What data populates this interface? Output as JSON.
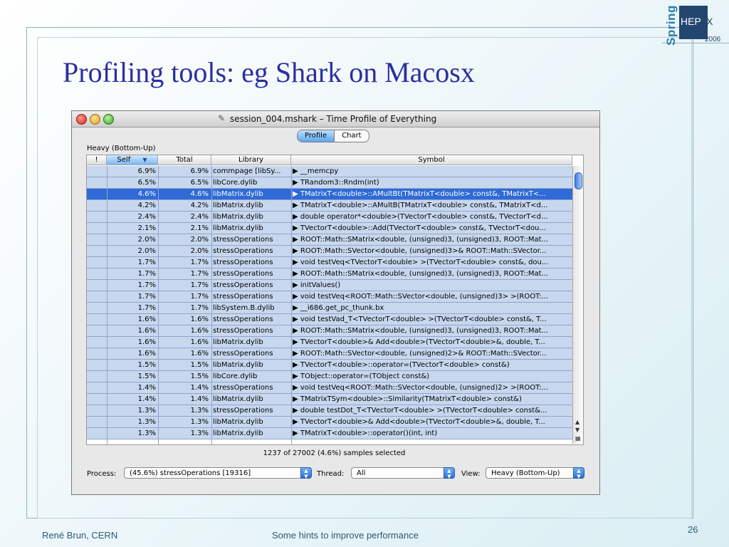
{
  "logo": {
    "spring": "Spring",
    "hep": "HEP",
    "ix": "iX",
    "year": "2006"
  },
  "slide": {
    "title": "Profiling tools: eg Shark on Macosx",
    "footer_left": "René Brun, CERN",
    "footer_center": "Some hints to improve performance",
    "page_number": "26"
  },
  "window": {
    "title": "session_004.mshark – Time Profile of Everything",
    "tabs": [
      "Profile",
      "Chart"
    ],
    "pane_label": "Heavy (Bottom-Up)",
    "columns": [
      "!",
      "Self",
      "Total",
      "Library",
      "Symbol"
    ],
    "rows": [
      {
        "self": "6.9%",
        "total": "6.9%",
        "library": "commpage [libSy...",
        "symbol": "▶ __memcpy"
      },
      {
        "self": "6.5%",
        "total": "6.5%",
        "library": "libCore.dylib",
        "symbol": "▶ TRandom3::Rndm(int)"
      },
      {
        "self": "4.6%",
        "total": "4.6%",
        "library": "libMatrix.dylib",
        "symbol": "▶ TMatrixT<double>::AMultBt(TMatrixT<double> const&, TMatrixT<..."
      },
      {
        "self": "4.2%",
        "total": "4.2%",
        "library": "libMatrix.dylib",
        "symbol": "▶ TMatrixT<double>::AMultB(TMatrixT<double> const&, TMatrixT<d..."
      },
      {
        "self": "2.4%",
        "total": "2.4%",
        "library": "libMatrix.dylib",
        "symbol": "▶ double operator*<double>(TVectorT<double> const&, TVectorT<d..."
      },
      {
        "self": "2.1%",
        "total": "2.1%",
        "library": "libMatrix.dylib",
        "symbol": "▶ TVectorT<double>::Add(TVectorT<double> const&, TVectorT<dou..."
      },
      {
        "self": "2.0%",
        "total": "2.0%",
        "library": "stressOperations",
        "symbol": "▶ ROOT::Math::SMatrix<double, (unsigned)3, (unsigned)3, ROOT::Mat..."
      },
      {
        "self": "2.0%",
        "total": "2.0%",
        "library": "stressOperations",
        "symbol": "▶ ROOT::Math::SVector<double, (unsigned)3>& ROOT::Math::SVector..."
      },
      {
        "self": "1.7%",
        "total": "1.7%",
        "library": "stressOperations",
        "symbol": "▶ void testVeq<TVectorT<double> >(TVectorT<double> const&, dou..."
      },
      {
        "self": "1.7%",
        "total": "1.7%",
        "library": "stressOperations",
        "symbol": "▶ ROOT::Math::SMatrix<double, (unsigned)3, (unsigned)3, ROOT::Mat..."
      },
      {
        "self": "1.7%",
        "total": "1.7%",
        "library": "stressOperations",
        "symbol": "▶ initValues()"
      },
      {
        "self": "1.7%",
        "total": "1.7%",
        "library": "stressOperations",
        "symbol": "▶ void testVeq<ROOT::Math::SVector<double, (unsigned)3> >(ROOT:..."
      },
      {
        "self": "1.7%",
        "total": "1.7%",
        "library": "libSystem.B.dylib",
        "symbol": "▶ __i686.get_pc_thunk.bx"
      },
      {
        "self": "1.6%",
        "total": "1.6%",
        "library": "stressOperations",
        "symbol": "▶ void testVad_T<TVectorT<double> >(TVectorT<double> const&, T..."
      },
      {
        "self": "1.6%",
        "total": "1.6%",
        "library": "stressOperations",
        "symbol": "▶ ROOT::Math::SMatrix<double, (unsigned)3, (unsigned)3, ROOT::Mat..."
      },
      {
        "self": "1.6%",
        "total": "1.6%",
        "library": "libMatrix.dylib",
        "symbol": "▶ TVectorT<double>& Add<double>(TVectorT<double>&, double, T..."
      },
      {
        "self": "1.6%",
        "total": "1.6%",
        "library": "stressOperations",
        "symbol": "▶ ROOT::Math::SVector<double, (unsigned)2>& ROOT::Math::SVector..."
      },
      {
        "self": "1.5%",
        "total": "1.5%",
        "library": "libMatrix.dylib",
        "symbol": "▶ TVectorT<double>::operator=(TVectorT<double> const&)"
      },
      {
        "self": "1.5%",
        "total": "1.5%",
        "library": "libCore.dylib",
        "symbol": "▶ TObject::operator=(TObject const&)"
      },
      {
        "self": "1.4%",
        "total": "1.4%",
        "library": "stressOperations",
        "symbol": "▶ void testVeq<ROOT::Math::SVector<double, (unsigned)2> >(ROOT:..."
      },
      {
        "self": "1.4%",
        "total": "1.4%",
        "library": "libMatrix.dylib",
        "symbol": "▶ TMatrixTSym<double>::Similarity(TMatrixT<double> const&)"
      },
      {
        "self": "1.3%",
        "total": "1.3%",
        "library": "stressOperations",
        "symbol": "▶ double testDot_T<TVectorT<double> >(TVectorT<double> const&..."
      },
      {
        "self": "1.3%",
        "total": "1.3%",
        "library": "libMatrix.dylib",
        "symbol": "▶ TVectorT<double>& Add<double>(TVectorT<double>&, double, T..."
      },
      {
        "self": "1.3%",
        "total": "1.3%",
        "library": "libMatrix.dylib",
        "symbol": "▶ TMatrixT<double>::operator()(int, int)"
      }
    ],
    "selected_row": 2,
    "status": "1237 of 27002 (4.6%) samples selected",
    "process_label": "Process:",
    "process_value": "(45.6%) stressOperations [19316]",
    "thread_label": "Thread:",
    "thread_value": "All",
    "view_label": "View:",
    "view_value": "Heavy (Bottom-Up)"
  },
  "colors": {
    "title": "#2b2fa0",
    "row": "#c7d7ee",
    "selected_row": "#2f6ad6"
  }
}
